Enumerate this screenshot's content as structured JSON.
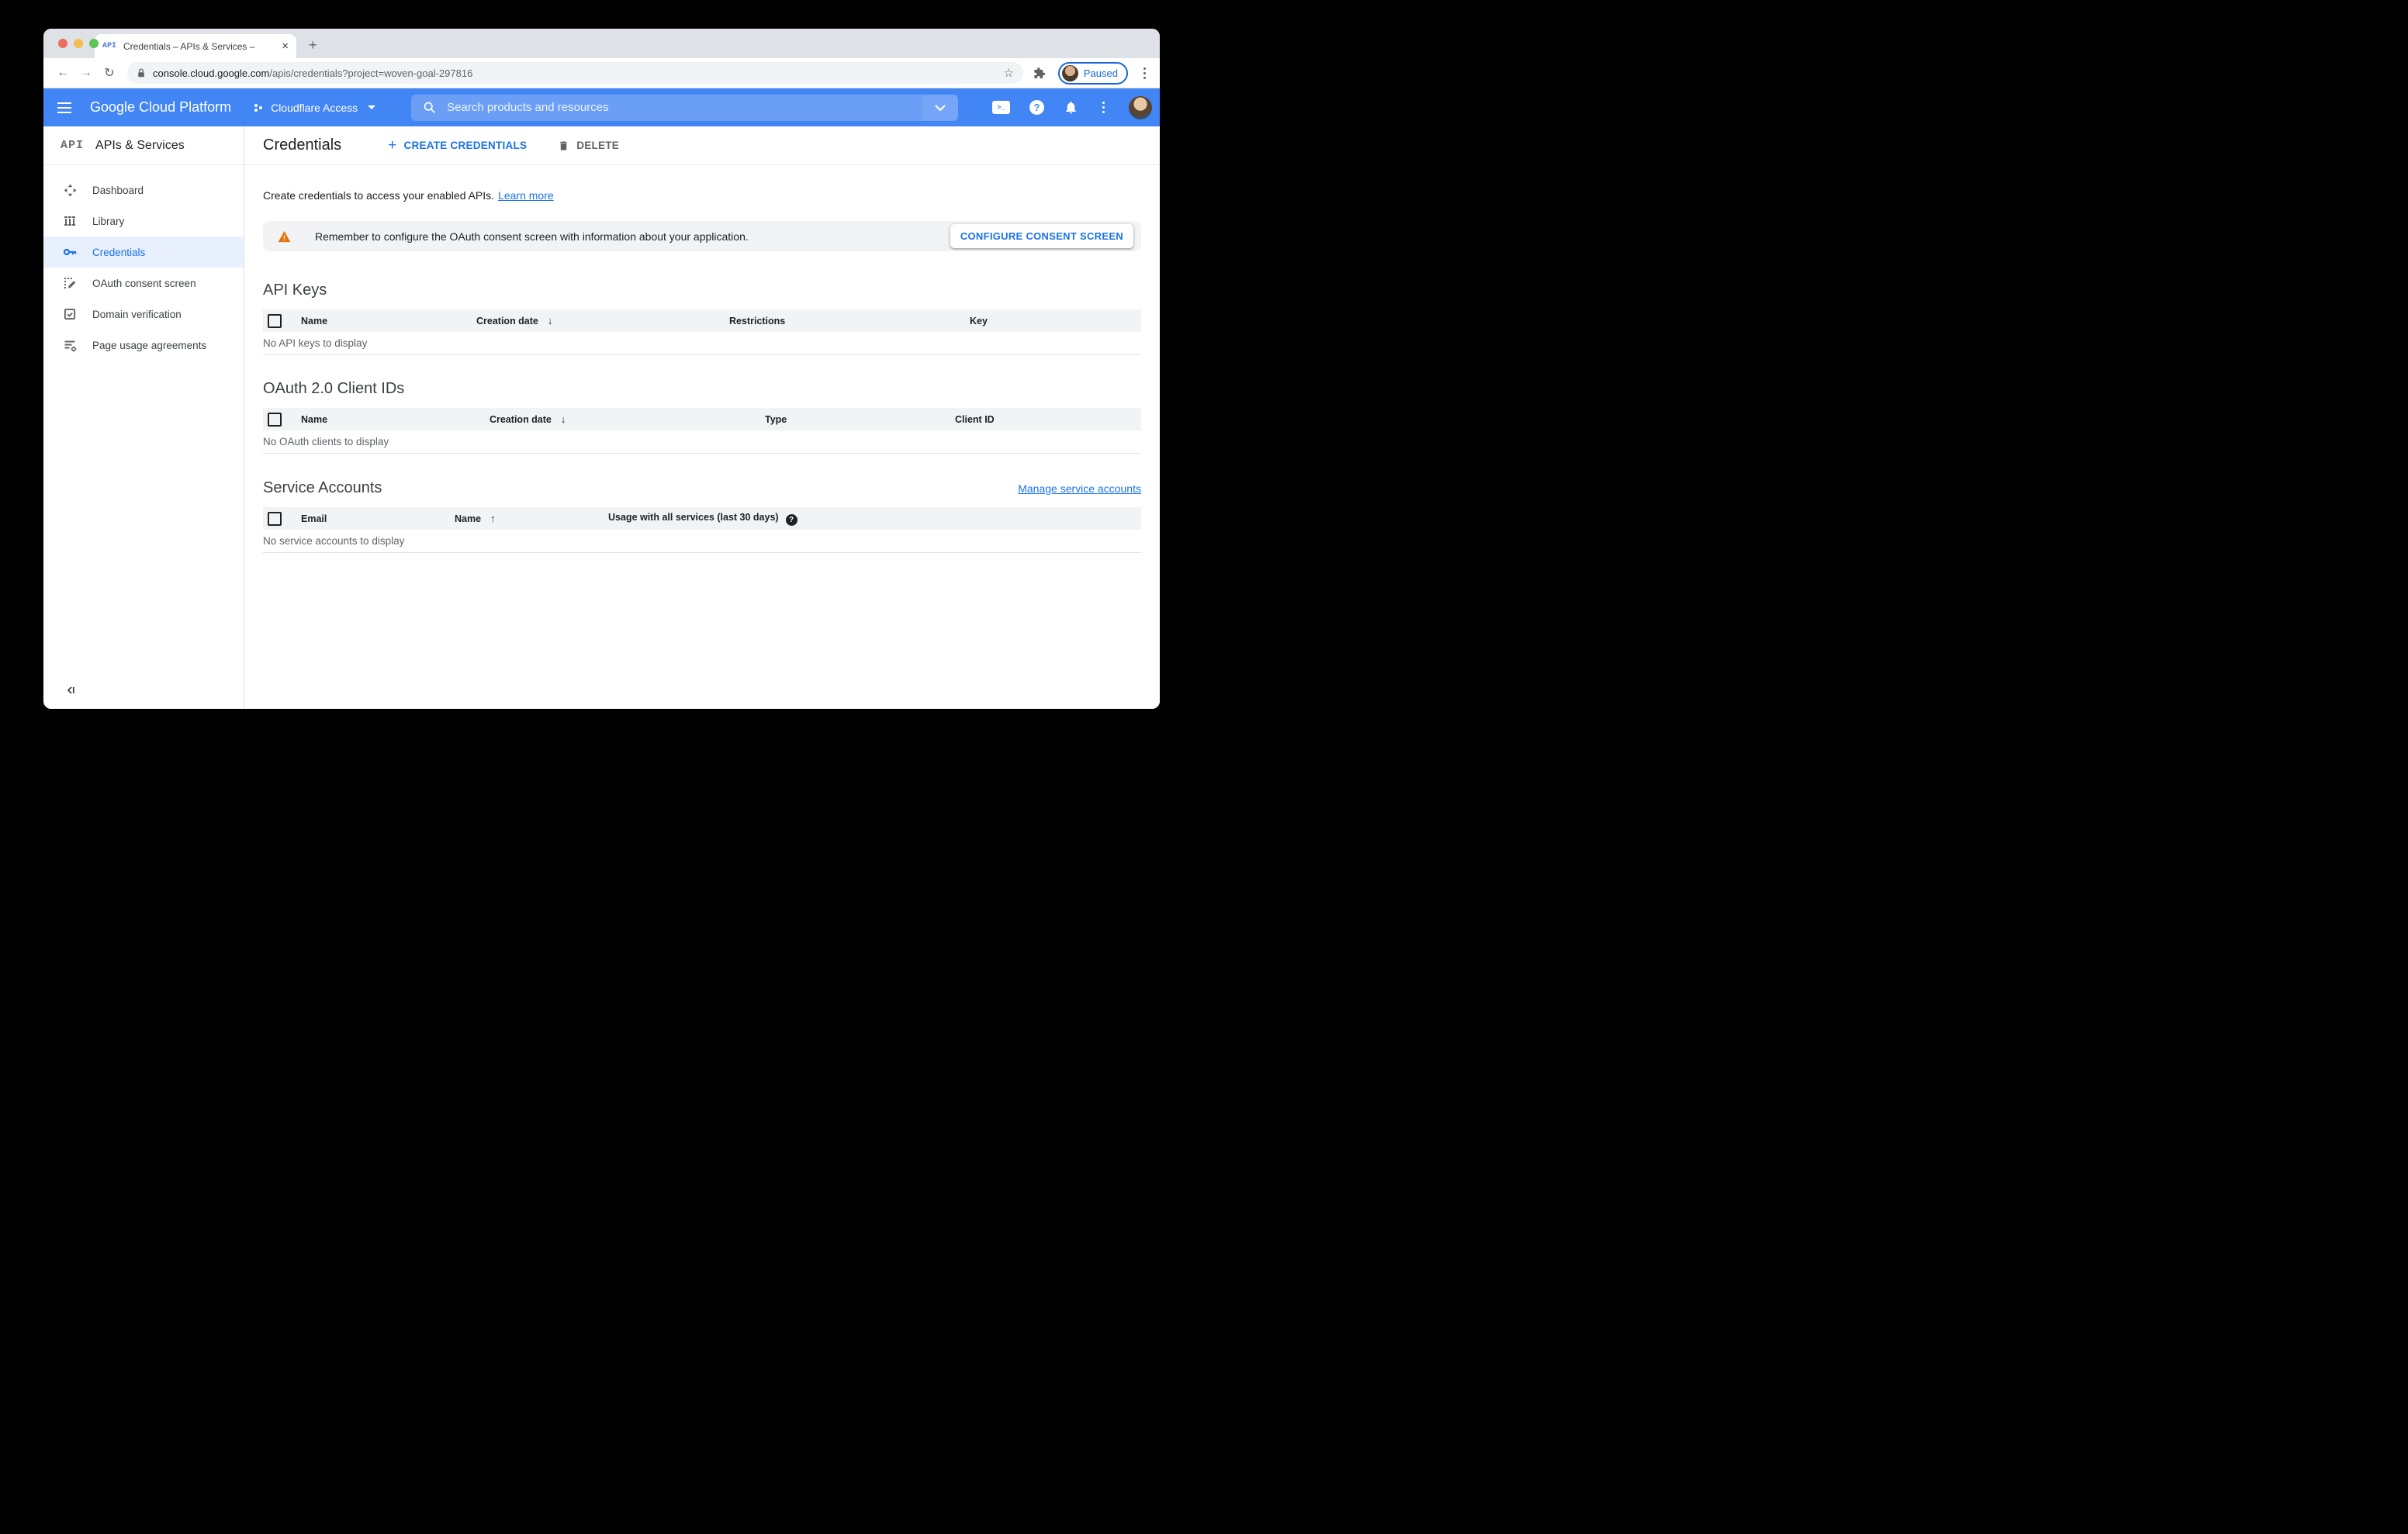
{
  "colors": {
    "accent_blue": "#1a73e8",
    "header_blue": "#4285f4",
    "warning_orange": "#e8710a",
    "selected_bg": "#e8f0fe"
  },
  "browser": {
    "tab_favicon": "API",
    "tab_title": "Credentials – APIs & Services –",
    "close_glyph": "×",
    "new_tab_glyph": "+",
    "back_glyph": "←",
    "forward_glyph": "→",
    "reload_glyph": "↻",
    "url_domain": "console.cloud.google.com",
    "url_path": "/apis/credentials?project=woven-goal-297816",
    "star_glyph": "☆",
    "paused_label": "Paused"
  },
  "gcp": {
    "product": "Google Cloud Platform",
    "project": "Cloudflare Access",
    "search_placeholder": "Search products and resources",
    "shell_glyph": ">_",
    "help_glyph": "?"
  },
  "sidebar": {
    "logo": "API",
    "title": "APIs & Services",
    "items": [
      {
        "label": "Dashboard"
      },
      {
        "label": "Library"
      },
      {
        "label": "Credentials"
      },
      {
        "label": "OAuth consent screen"
      },
      {
        "label": "Domain verification"
      },
      {
        "label": "Page usage agreements"
      }
    ]
  },
  "content": {
    "page_title": "Credentials",
    "create_plus": "+",
    "create_label": "CREATE CREDENTIALS",
    "delete_label": "DELETE",
    "intro": "Create credentials to access your enabled APIs.",
    "learn_more": "Learn more",
    "warning_text": "Remember to configure the OAuth consent screen with information about your application.",
    "configure_button": "CONFIGURE CONSENT SCREEN",
    "api_keys": {
      "title": "API Keys",
      "col_name": "Name",
      "col_creation": "Creation date",
      "sort_arrow": "↓",
      "col_restrictions": "Restrictions",
      "col_key": "Key",
      "empty": "No API keys to display"
    },
    "oauth": {
      "title": "OAuth 2.0 Client IDs",
      "col_name": "Name",
      "col_creation": "Creation date",
      "sort_arrow": "↓",
      "col_type": "Type",
      "col_client_id": "Client ID",
      "empty": "No OAuth clients to display"
    },
    "service_accounts": {
      "title": "Service Accounts",
      "manage_link": "Manage service accounts",
      "col_email": "Email",
      "col_name": "Name",
      "sort_arrow": "↑",
      "col_usage": "Usage with all services (last 30 days)",
      "help_glyph": "?",
      "empty": "No service accounts to display"
    }
  }
}
